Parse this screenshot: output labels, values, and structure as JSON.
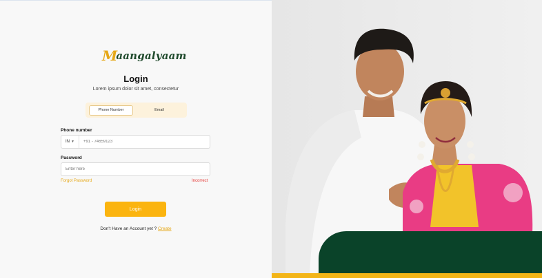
{
  "brand": {
    "logo_text": "Maangalyaam",
    "logo_mark": "M"
  },
  "login": {
    "title": "Login",
    "subtitle": "Lorem ipsum dolor sit amet, consectetur",
    "tabs": [
      {
        "label": "Phone Number",
        "active": true
      },
      {
        "label": "Email",
        "active": false
      }
    ],
    "phone": {
      "label": "Phone number",
      "country_code": "IN",
      "placeholder": "+91 - 74659123"
    },
    "password": {
      "label": "Password",
      "placeholder": "Enter here"
    },
    "forgot_label": "Forgot Password",
    "error_label": "Incorrect",
    "submit_label": "Login",
    "signup_prompt": "Don't Have an Account yet ? ",
    "signup_link": "Create"
  },
  "colors": {
    "accent": "#fbb40f",
    "brand_green": "#0a4329",
    "error": "#e53935"
  }
}
